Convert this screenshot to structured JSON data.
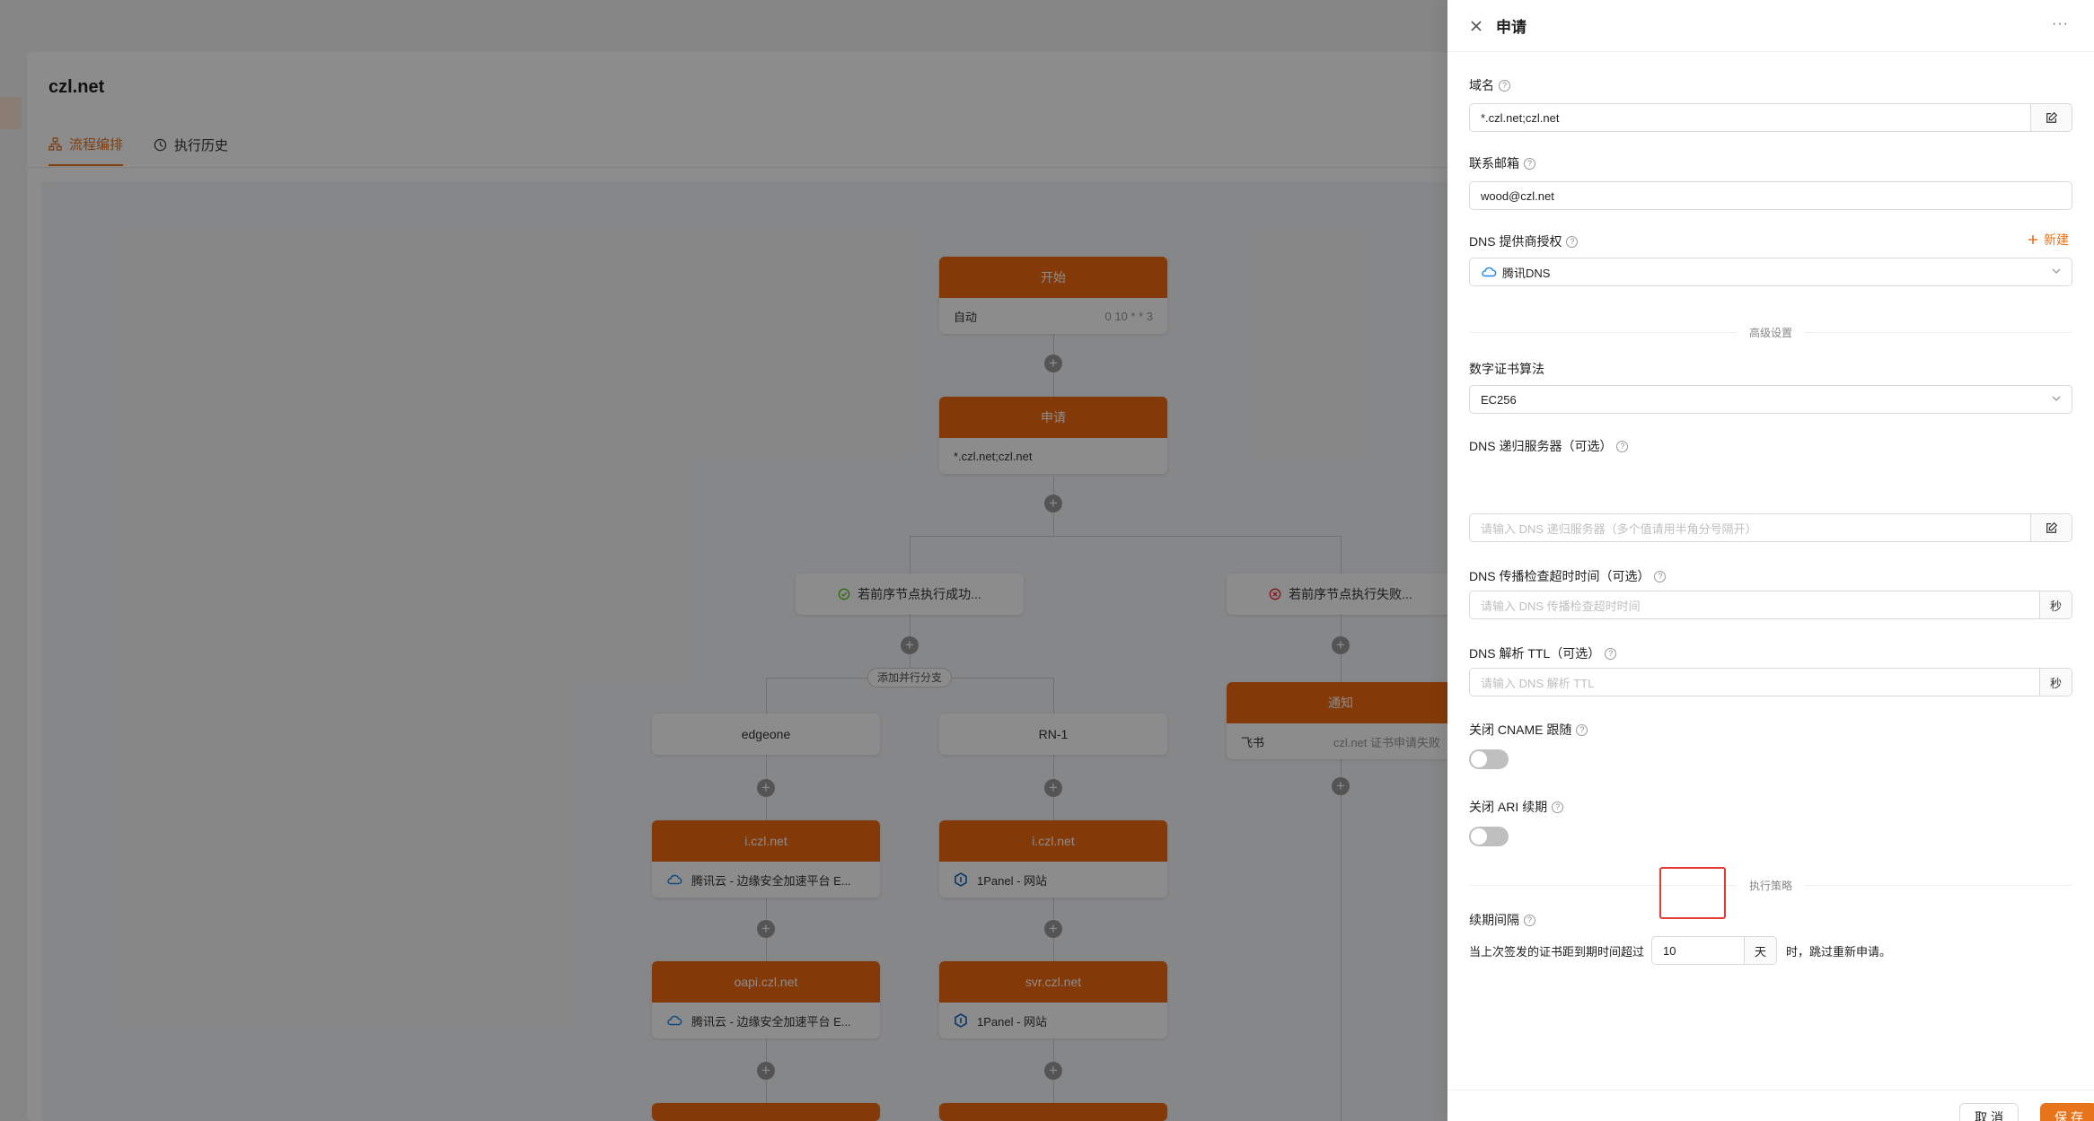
{
  "page": {
    "title": "czl.net",
    "tabs": [
      {
        "label": "流程编排",
        "icon": "flow-icon",
        "active": true
      },
      {
        "label": "执行历史",
        "icon": "history-icon",
        "active": false
      }
    ]
  },
  "flow": {
    "start": {
      "title": "开始",
      "trigger": "自动",
      "cron": "0 10 * * 3"
    },
    "apply": {
      "title": "申请",
      "domain": "*.czl.net;czl.net"
    },
    "cond_success": "若前序节点执行成功...",
    "cond_fail": "若前序节点执行失败...",
    "add_branch": "添加并行分支",
    "branches": [
      "edgeone",
      "RN-1"
    ],
    "notify": {
      "title": "通知",
      "channel": "飞书",
      "message": "czl.net 证书申请失败"
    },
    "deploy_nodes": [
      {
        "title": "i.czl.net",
        "provider": "腾讯云 - 边缘安全加速平台 E...",
        "icon": "tencent-cloud-icon"
      },
      {
        "title": "i.czl.net",
        "provider": "1Panel - 网站",
        "icon": "1panel-icon"
      },
      {
        "title": "oapi.czl.net",
        "provider": "腾讯云 - 边缘安全加速平台 E...",
        "icon": "tencent-cloud-icon"
      },
      {
        "title": "svr.czl.net",
        "provider": "1Panel - 网站",
        "icon": "1panel-icon"
      }
    ]
  },
  "drawer": {
    "title": "申请",
    "fields": {
      "domain": {
        "label": "域名",
        "value": "*.czl.net;czl.net"
      },
      "email": {
        "label": "联系邮箱",
        "value": "wood@czl.net"
      },
      "dns_provider": {
        "label": "DNS 提供商授权",
        "new_label": "新建",
        "value": "腾讯DNS"
      },
      "advanced_divider": "高级设置",
      "algorithm": {
        "label": "数字证书算法",
        "value": "EC256"
      },
      "dns_resolver": {
        "label": "DNS 递归服务器（可选）",
        "placeholder": "请输入 DNS 递归服务器（多个值请用半角分号隔开）"
      },
      "dns_timeout": {
        "label": "DNS 传播检查超时时间（可选）",
        "placeholder": "请输入 DNS 传播检查超时时间",
        "unit": "秒"
      },
      "dns_ttl": {
        "label": "DNS 解析 TTL（可选）",
        "placeholder": "请输入 DNS 解析 TTL",
        "unit": "秒"
      },
      "disable_cname": {
        "label": "关闭 CNAME 跟随",
        "on": false
      },
      "disable_ari": {
        "label": "关闭 ARI 续期",
        "on": false
      },
      "policy_divider": "执行策略",
      "renew": {
        "label": "续期间隔",
        "prefix": "当上次签发的证书距到期时间超过",
        "value": "10",
        "unit": "天",
        "suffix": "时，跳过重新申请。"
      }
    },
    "footer": {
      "cancel": "取 消",
      "save": "保 存"
    }
  },
  "colors": {
    "accent": "#e8741c",
    "node_header": "#f06a0f",
    "highlight": "#e53935"
  }
}
